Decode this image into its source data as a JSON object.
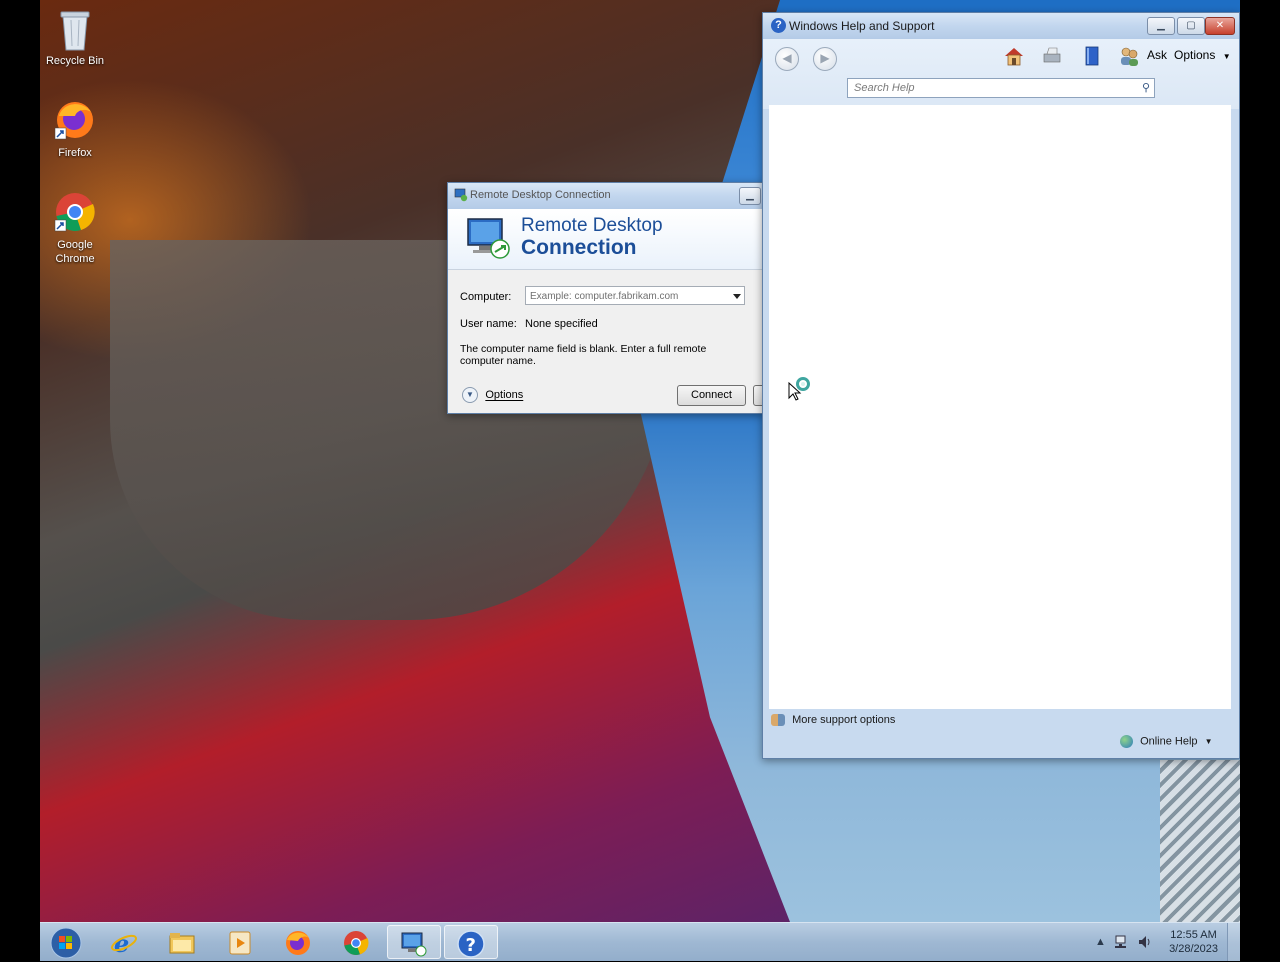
{
  "desktop": {
    "icons": [
      {
        "label": "Recycle Bin"
      },
      {
        "label": "Firefox"
      },
      {
        "label": "Google Chrome"
      }
    ]
  },
  "rdc": {
    "title": "Remote Desktop Connection",
    "banner_line1": "Remote Desktop",
    "banner_line2": "Connection",
    "computer_label": "Computer:",
    "computer_placeholder": "Example: computer.fabrikam.com",
    "username_label": "User name:",
    "username_value": "None specified",
    "message": "The computer name field is blank. Enter a full remote computer name.",
    "options_label": "Options",
    "connect_label": "Connect"
  },
  "help": {
    "title": "Windows Help and Support",
    "ask_label": "Ask",
    "options_label": "Options",
    "search_placeholder": "Search Help",
    "more_support": "More support options",
    "online_help": "Online Help"
  },
  "taskbar": {
    "time": "12:55 AM",
    "date": "3/28/2023",
    "items": [
      "start",
      "internet-explorer",
      "windows-explorer",
      "media-player",
      "firefox",
      "chrome",
      "remote-desktop",
      "help-and-support"
    ]
  }
}
